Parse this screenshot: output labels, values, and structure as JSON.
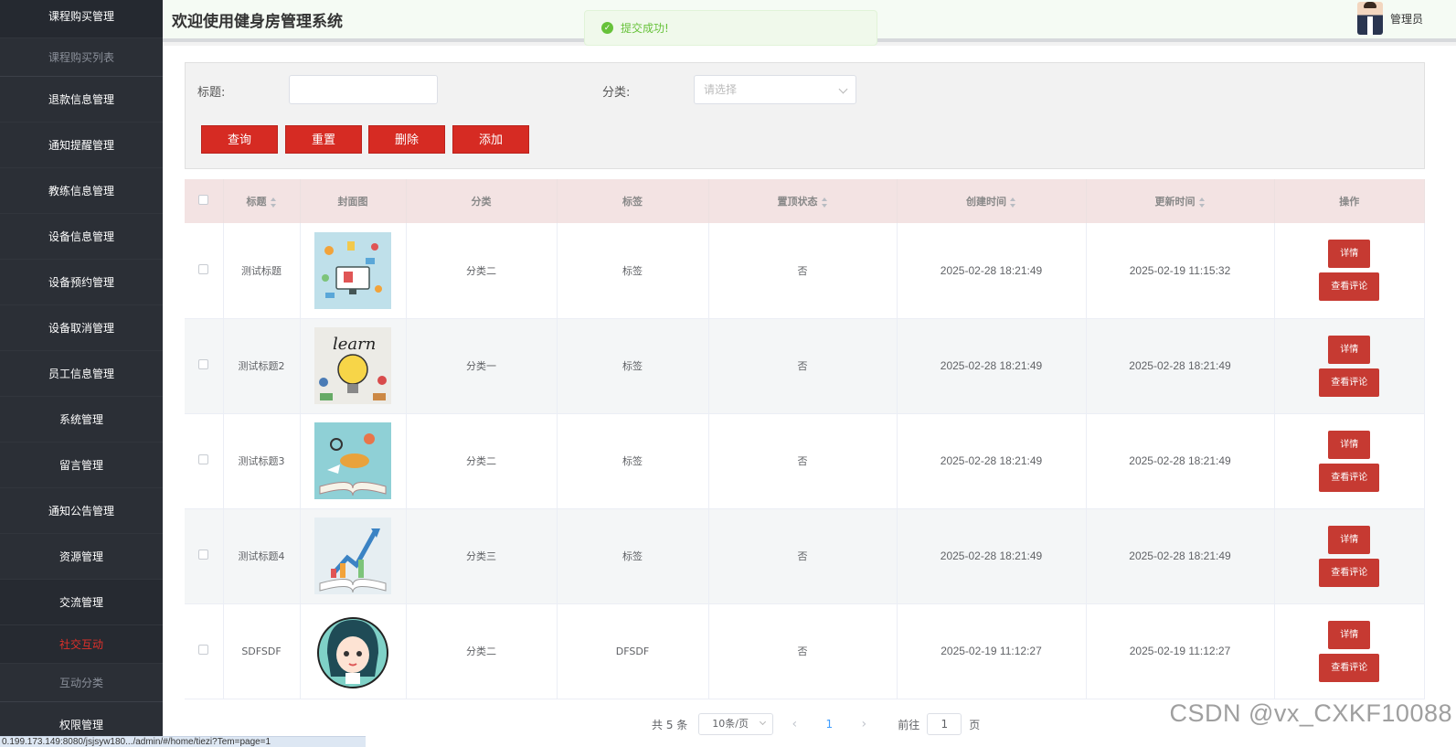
{
  "sidebar": {
    "items": [
      {
        "label": "课程购买管理",
        "kind": "first"
      },
      {
        "label": "课程购买列表",
        "kind": "sub"
      },
      {
        "label": "退款信息管理",
        "kind": "item"
      },
      {
        "label": "通知提醒管理",
        "kind": "item"
      },
      {
        "label": "教练信息管理",
        "kind": "item"
      },
      {
        "label": "设备信息管理",
        "kind": "item"
      },
      {
        "label": "设备预约管理",
        "kind": "item"
      },
      {
        "label": "设备取消管理",
        "kind": "item"
      },
      {
        "label": "员工信息管理",
        "kind": "item"
      },
      {
        "label": "系统管理",
        "kind": "item"
      },
      {
        "label": "留言管理",
        "kind": "item"
      },
      {
        "label": "通知公告管理",
        "kind": "item"
      },
      {
        "label": "资源管理",
        "kind": "item"
      },
      {
        "label": "交流管理",
        "kind": "open"
      },
      {
        "label": "社交互动",
        "kind": "active"
      },
      {
        "label": "互动分类",
        "kind": "sub"
      },
      {
        "label": "权限管理",
        "kind": "item"
      }
    ]
  },
  "header": {
    "title": "欢迎使用健身房管理系统",
    "user_name": "管理员"
  },
  "toast": {
    "text": "提交成功!",
    "icon": "check-circle-icon"
  },
  "search": {
    "title_label": "标题:",
    "title_value": "",
    "category_label": "分类:",
    "category_placeholder": "请选择",
    "buttons": {
      "query": "查询",
      "reset": "重置",
      "delete": "删除",
      "add": "添加"
    }
  },
  "table": {
    "headers": {
      "title": "标题",
      "cover": "封面图",
      "category": "分类",
      "tag": "标签",
      "pinned": "置顶状态",
      "created": "创建时间",
      "updated": "更新时间",
      "actions": "操作"
    },
    "rows": [
      {
        "title": "测试标题",
        "cover": "workspace-illustration",
        "category": "分类二",
        "tag": "标签",
        "pinned": "否",
        "created": "2025-02-28 18:21:49",
        "updated": "2025-02-19 11:15:32",
        "detail": "详情",
        "comment": "查看评论"
      },
      {
        "title": "测试标题2",
        "cover": "learn-bulb-illustration",
        "category": "分类一",
        "tag": "标签",
        "pinned": "否",
        "created": "2025-02-28 18:21:49",
        "updated": "2025-02-28 18:21:49",
        "detail": "详情",
        "comment": "查看评论"
      },
      {
        "title": "测试标题3",
        "cover": "open-book-illustration",
        "category": "分类二",
        "tag": "标签",
        "pinned": "否",
        "created": "2025-02-28 18:21:49",
        "updated": "2025-02-28 18:21:49",
        "detail": "详情",
        "comment": "查看评论"
      },
      {
        "title": "测试标题4",
        "cover": "book-growth-illustration",
        "category": "分类三",
        "tag": "标签",
        "pinned": "否",
        "created": "2025-02-28 18:21:49",
        "updated": "2025-02-28 18:21:49",
        "detail": "详情",
        "comment": "查看评论"
      },
      {
        "title": "SDFSDF",
        "cover": "girl-avatar-illustration",
        "category": "分类二",
        "tag": "DFSDF",
        "pinned": "否",
        "created": "2025-02-19 11:12:27",
        "updated": "2025-02-19 11:12:27",
        "detail": "详情",
        "comment": "查看评论"
      }
    ]
  },
  "pagination": {
    "total": "共 5 条",
    "page_size": "10条/页",
    "prev": "‹",
    "current": "1",
    "next": "›",
    "goto_label": "前往",
    "goto_value": "1",
    "page_suffix": "页"
  },
  "statusbar": {
    "url": "0.199.173.149:8080/jsjsyw180.../admin/#/home/tiezi?Tem=page=1"
  },
  "watermark": "CSDN @vx_CXKF10088",
  "colors": {
    "accent": "#d62b23",
    "sidebar": "#2b2f36",
    "header_bg": "#f5fbf4",
    "table_header": "#f3e3e3",
    "success": "#67c23a"
  }
}
